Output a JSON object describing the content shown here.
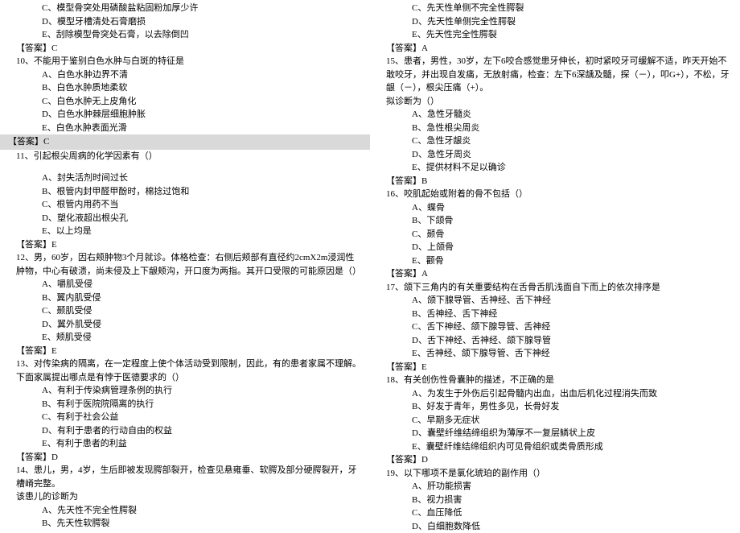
{
  "left": {
    "q9c": "C、模型骨突处用磷酸盐粘固粉加厚少许",
    "q9d": "D、模型牙槽清处石膏磨损",
    "q9e": "E、刮除模型骨突处石膏，以去除倒凹",
    "a9": "【答案】C",
    "q10": "10、不能用于鉴别白色水肿与白斑的特征是",
    "q10a": "A、白色水肿边界不清",
    "q10b": "B、白色水肿质地柔软",
    "q10c": "C、白色水肿无上皮角化",
    "q10d": "D、白色水肿棘层细胞肿胀",
    "q10e": "E、白色水肿表面光滑",
    "a10": "【答案】C",
    "q11": "11、引起根尖周病的化学因素有（）",
    "q11a": "A、封失活剂时间过长",
    "q11b": "B、根管内封甲醛甲酚时，棉捻过饱和",
    "q11c": "C、根管内用药不当",
    "q11d": "D、塑化液超出根尖孔",
    "q11e": "E、以上均是",
    "a11": "【答案】E",
    "q12": "12、男，60岁，因右颊肿物3个月就诊。体格检查：右侧后颊部有直径约2cmX2m浸润性肿物，中心有破溃，尚未侵及上下龈颊沟，开口度为两指。其开口受限的可能原因是（）",
    "q12a": "A、嚼肌受侵",
    "q12b": "B、翼内肌受侵",
    "q12c": "C、颞肌受侵",
    "q12d": "D、翼外肌受侵",
    "q12e": "E、颊肌受侵",
    "a12": "【答案】E",
    "q13": "13、对传染病的隔离，在一定程度上使个体活动受到限制，因此，有的患者家属不理解。下面家属提出哪点是有悖于医德要求的（）",
    "q13a": "A、有利于传染病管理条例的执行",
    "q13b": "B、有利于医院院隔离的执行",
    "q13c": "C、有利于社会公益",
    "q13d": "D、有利于患者的行动自由的权益",
    "q13e": "E、有利于患者的利益",
    "a13": "【答案】D",
    "q14": "14、患儿，男，4岁，生后即被发现腭部裂开，检查见悬雍垂、软腭及部分硬腭裂开，牙槽嵴完整。",
    "q14_2": "该患儿的诊断为",
    "q14a": "A、先天性不完全性腭裂",
    "q14b": "B、先天性软腭裂"
  },
  "right": {
    "q14c": "C、先天性单侧不完全性腭裂",
    "q14d": "D、先天性单侧完全性腭裂",
    "q14e": "E、先天性完全性腭裂",
    "a14": "【答案】A",
    "q15": "15、患者，男性，30岁，左下6咬合感觉患牙伸长，初时紧咬牙可缓解不适，昨天开始不敢咬牙，并出现自发痛，无放射痛，检查：左下6深龋及髓，探（－），叩G+），不松，牙龈（－），根尖压痛（+）。",
    "q15_2": "拟诊断为（）",
    "q15a": "A、急性牙髓炎",
    "q15b": "B、急性根尖周炎",
    "q15c": "C、急性牙龈炎",
    "q15d": "D、急性牙周炎",
    "q15e": "E、提供材料不足以确诊",
    "a15": "【答案】B",
    "q16": "16、咬肌起始或附着的骨不包括（）",
    "q16a": "A、蝶骨",
    "q16b": "B、下颌骨",
    "q16c": "C、颞骨",
    "q16d": "D、上颌骨",
    "q16e": "E、颧骨",
    "a16": "【答案】A",
    "q17": "17、颌下三角内的有关重要结构在舌骨舌肌浅面自下而上的依次排序是",
    "q17a": "A、颌下腺导管、舌神经、舌下神经",
    "q17b": "B、舌神经、舌下神经",
    "q17c": "C、舌下神经、颌下腺导管、舌神经",
    "q17d": "D、舌下神经、舌神经、颌下腺导管",
    "q17e": "E、舌神经、颌下腺导管、舌下神经",
    "a17": "【答案】E",
    "q18": "18、有关创伤性骨囊肿的描述，不正确的是",
    "q18a": "A、为发生于外伤后引起骨髓内出血，出血后机化过程消失而致",
    "q18b": "B、好发于青年，男性多见，长骨好发",
    "q18c": "C、早期多无症状",
    "q18d": "D、囊壁纤维结缔组织为薄厚不一复层鳞状上皮",
    "q18e": "E、囊壁纤维结缔组织内可见骨组织或类骨质形成",
    "a18": "【答案】D",
    "q19": "19、以下哪项不是氯化琥珀的副作用（）",
    "q19a": "A、肝功能损害",
    "q19b": "B、视力损害",
    "q19c": "C、血压降低",
    "q19d": "D、白细胞数降低"
  }
}
